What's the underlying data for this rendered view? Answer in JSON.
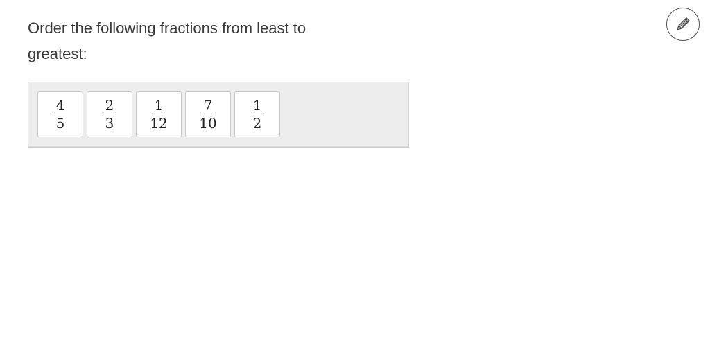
{
  "question": {
    "text": "Order the following fractions from least to greatest:"
  },
  "toolbar": {
    "scratchpad_icon": "pencil-icon"
  },
  "sorter": {
    "cards": [
      {
        "numerator": "4",
        "denominator": "5"
      },
      {
        "numerator": "2",
        "denominator": "3"
      },
      {
        "numerator": "1",
        "denominator": "12"
      },
      {
        "numerator": "7",
        "denominator": "10"
      },
      {
        "numerator": "1",
        "denominator": "2"
      }
    ]
  },
  "colors": {
    "tray_background": "#ededed",
    "card_border": "#c8c8c8",
    "text": "#3b3b3b"
  }
}
